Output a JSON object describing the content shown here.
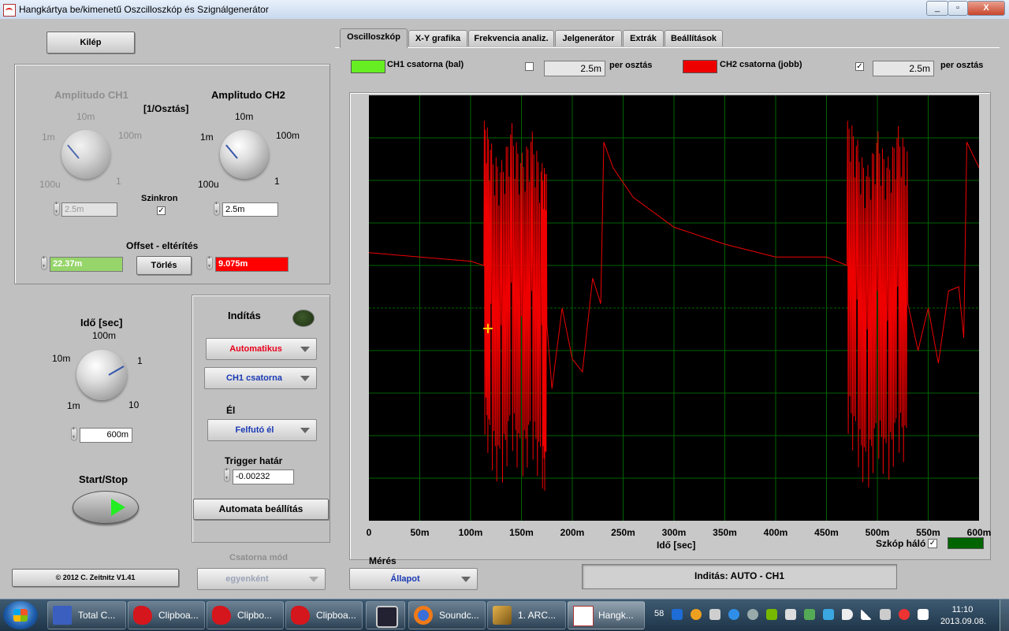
{
  "window": {
    "title": "Hangkártya be/kimenetű Oszcilloszkóp és Szignálgenerátor",
    "buttons": [
      "_",
      "▫",
      "X"
    ]
  },
  "left": {
    "quit_label": "Kilép",
    "amp_ch1": {
      "title": "Amplitudo CH1",
      "ticks": [
        "1m",
        "10m",
        "100m",
        "100u",
        "1"
      ],
      "value": "2.5m"
    },
    "amp_ch2": {
      "title": "Amplitudo CH2",
      "ticks": [
        "1m",
        "10m",
        "100m",
        "100u",
        "1"
      ],
      "value": "2.5m"
    },
    "unit_label": "[1/Osztás]",
    "sync_label": "Szinkron",
    "sync_checked": "✓",
    "offset_label": "Offset - eltérítés",
    "offset_ch1": "22.37m",
    "offset_ch2": "9.075m",
    "clear_label": "Törlés",
    "time": {
      "title": "Idő [sec]",
      "ticks": [
        "10m",
        "100m",
        "1",
        "1m",
        "10"
      ],
      "value": "600m"
    },
    "startstop_label": "Start/Stop",
    "copyright": "© 2012  C. Zeitnitz V1.41",
    "channel_mode": {
      "title": "Csatorna mód",
      "value": "egyenként"
    }
  },
  "trigger": {
    "title": "Indítás",
    "mode": "Automatikus",
    "channel": "CH1 csatorna",
    "edge_title": "Él",
    "edge": "Felfutó él",
    "level_title": "Trigger határ",
    "level_value": "-0.00232",
    "auto_setup": "Automata beállítás"
  },
  "tabs": [
    "Oscilloszkóp",
    "X-Y grafika",
    "Frekvencia analiz.",
    "Jelgenerátor",
    "Extrák",
    "Beállítások"
  ],
  "scope": {
    "ch1_label": "CH1 csatorna (bal)",
    "ch1_per_div": "2.5m",
    "ch1_checked": "",
    "ch2_label": "CH2 csatorna (jobb)",
    "ch2_per_div": "2.5m",
    "ch2_checked": "✓",
    "per_div_label": "per osztás",
    "x_ticks": [
      "0",
      "50m",
      "100m",
      "150m",
      "200m",
      "250m",
      "300m",
      "350m",
      "400m",
      "450m",
      "500m",
      "550m",
      "600m"
    ],
    "x_label": "Idő [sec]",
    "grid_label": "Szkóp háló",
    "grid_checked": "✓",
    "ch1_color": "#66ee22",
    "ch2_color": "#ee0000",
    "grid_color": "#006400"
  },
  "measure": {
    "title": "Mérés",
    "value": "Állapot"
  },
  "status_text": "Inditás: AUTO - CH1",
  "taskbar": {
    "items": [
      "Total C...",
      "Clipboa...",
      "Clipbo...",
      "Clipboa...",
      "",
      "Soundc...",
      "1. ARC...",
      "Hangk..."
    ],
    "tray_number": "58",
    "time": "11:10",
    "date": "2013.09.08."
  },
  "chart_data": {
    "type": "line",
    "xlabel": "Idő [sec]",
    "xlim": [
      0,
      0.6
    ],
    "ylim": [
      -5,
      5
    ],
    "series": [
      {
        "name": "CH2 csatorna (jobb)",
        "color": "#ee0000",
        "x": [
          0,
          0.05,
          0.1,
          0.113,
          0.12,
          0.13,
          0.14,
          0.15,
          0.16,
          0.17,
          0.175,
          0.18,
          0.19,
          0.2,
          0.21,
          0.22,
          0.228,
          0.231,
          0.24,
          0.26,
          0.3,
          0.35,
          0.4,
          0.45,
          0.47,
          0.48,
          0.49,
          0.5,
          0.51,
          0.52,
          0.53,
          0.54,
          0.55,
          0.56,
          0.57,
          0.58,
          0.585,
          0.588,
          0.6
        ],
        "y": [
          1.3,
          1.2,
          1.1,
          1.0,
          0.1,
          -0.4,
          0.6,
          -0.2,
          0.4,
          -0.4,
          -0.4,
          -1.9,
          0.0,
          -1.2,
          -1.5,
          0.7,
          0.1,
          3.9,
          3.3,
          2.6,
          1.9,
          1.5,
          1.2,
          1.2,
          1.0,
          0.2,
          -0.5,
          0.4,
          -0.3,
          0.5,
          0.1,
          -1.0,
          0.0,
          -1.3,
          0.4,
          0.5,
          -0.7,
          3.9,
          3.3
        ]
      }
    ]
  }
}
